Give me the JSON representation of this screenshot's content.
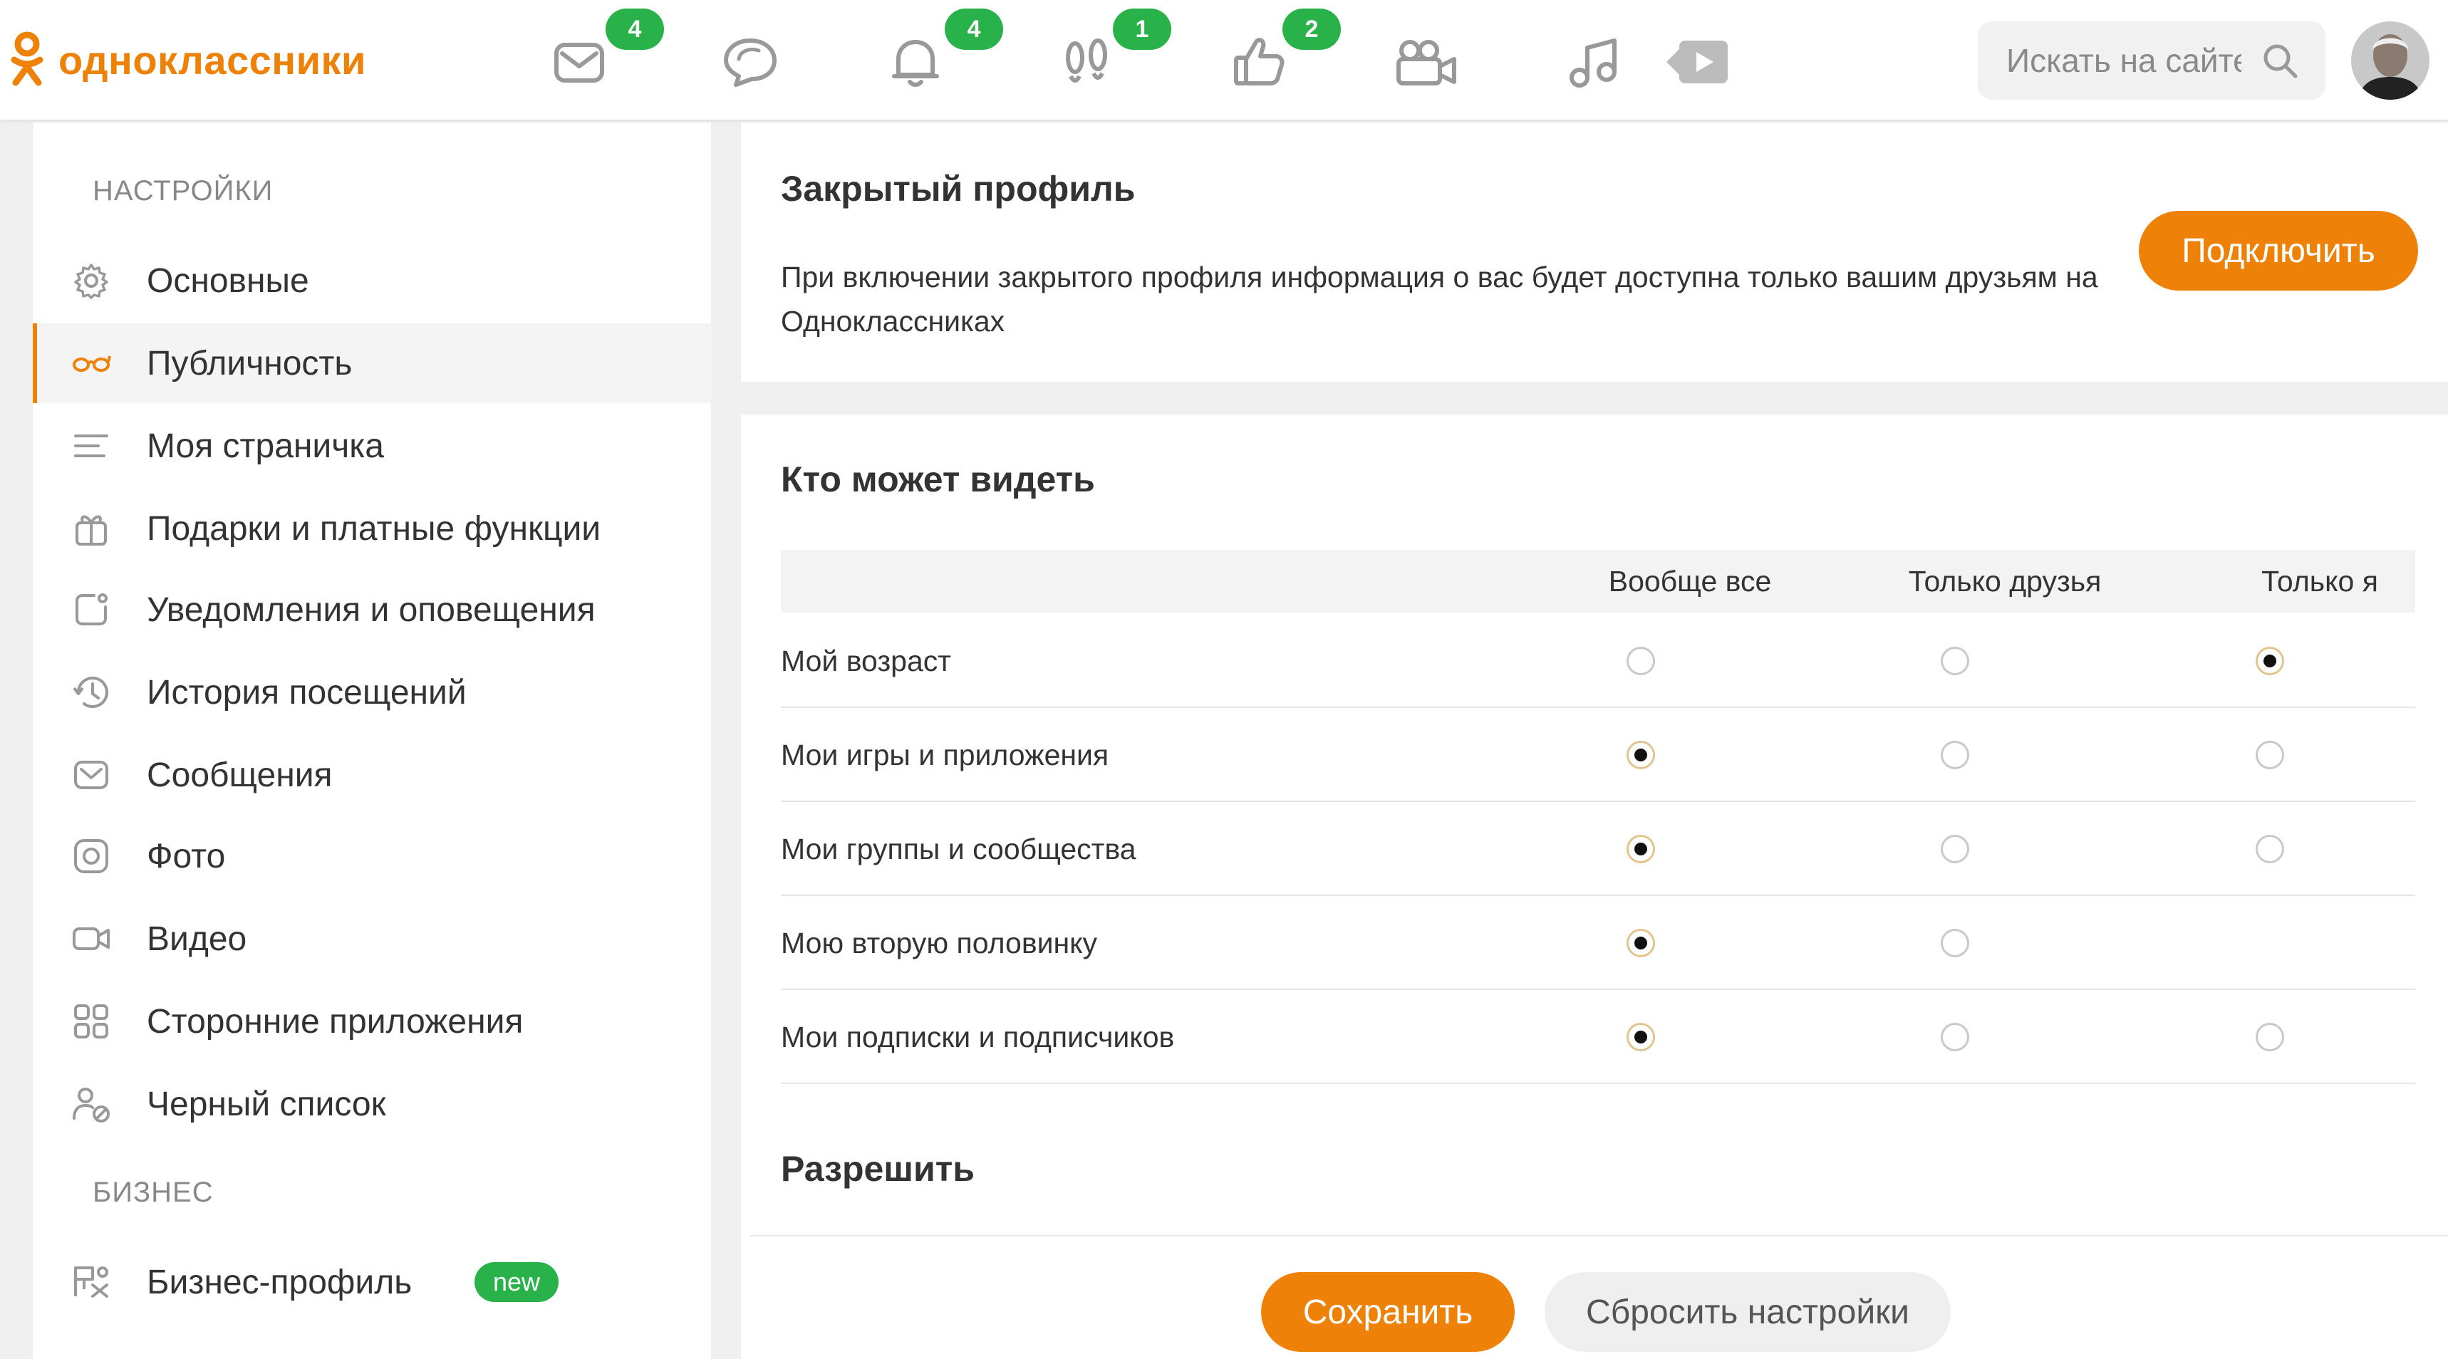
{
  "header": {
    "logo_text": "одноклассники",
    "nav": [
      {
        "icon": "mail-icon",
        "badge": "4"
      },
      {
        "icon": "chat-icon",
        "badge": ""
      },
      {
        "icon": "bell-icon",
        "badge": "4"
      },
      {
        "icon": "footprints-icon",
        "badge": "1"
      },
      {
        "icon": "thumbs-up-icon",
        "badge": "2"
      },
      {
        "icon": "video-camera-icon",
        "badge": ""
      },
      {
        "icon": "music-icon",
        "badge": ""
      },
      {
        "icon": "video-play-icon",
        "badge": ""
      }
    ],
    "search_placeholder": "Искать на сайте"
  },
  "sidebar": {
    "section_settings": "НАСТРОЙКИ",
    "items": [
      {
        "label": "Основные",
        "icon": "gear-icon"
      },
      {
        "label": "Публичность",
        "icon": "glasses-icon"
      },
      {
        "label": "Моя страничка",
        "icon": "lines-icon"
      },
      {
        "label": "Подарки и платные функции",
        "icon": "gift-icon"
      },
      {
        "label": "Уведомления и оповещения",
        "icon": "notification-icon"
      },
      {
        "label": "История посещений",
        "icon": "history-icon"
      },
      {
        "label": "Сообщения",
        "icon": "message-icon"
      },
      {
        "label": "Фото",
        "icon": "camera-icon"
      },
      {
        "label": "Видео",
        "icon": "video-icon"
      },
      {
        "label": "Сторонние приложения",
        "icon": "apps-icon"
      },
      {
        "label": "Черный список",
        "icon": "blocked-user-icon"
      }
    ],
    "section_business": "БИЗНЕС",
    "business_item": {
      "label": "Бизнес-профиль",
      "badge": "new",
      "icon": "business-icon"
    }
  },
  "closed_profile": {
    "title": "Закрытый профиль",
    "description": "При включении закрытого профиля информация о вас будет доступна только вашим друзьям на Одноклассниках",
    "button": "Подключить"
  },
  "visibility": {
    "title": "Кто может видеть",
    "columns": [
      "Вообще все",
      "Только друзья",
      "Только я"
    ],
    "rows": [
      {
        "label": "Мой возраст",
        "selected": 2,
        "options": 3
      },
      {
        "label": "Мои игры и приложения",
        "selected": 0,
        "options": 3
      },
      {
        "label": "Мои группы и сообщества",
        "selected": 0,
        "options": 3
      },
      {
        "label": "Мою вторую половинку",
        "selected": 0,
        "options": 2
      },
      {
        "label": "Мои подписки и подписчиков",
        "selected": 0,
        "options": 3
      }
    ]
  },
  "allow": {
    "title": "Разрешить"
  },
  "actions": {
    "save": "Сохранить",
    "reset": "Сбросить настройки"
  },
  "colors": {
    "accent": "#ee8208",
    "badge_green": "#2ab24a"
  }
}
